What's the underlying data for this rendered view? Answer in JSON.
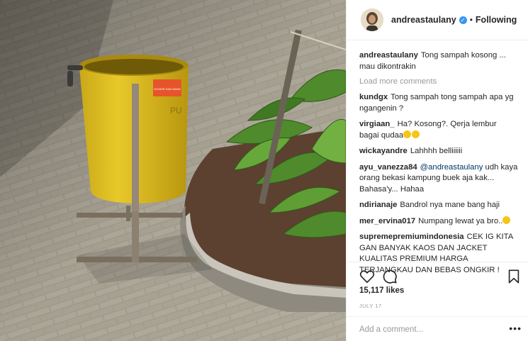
{
  "header": {
    "username": "andreastaulany",
    "verified_mark": "✓",
    "separator": "•",
    "follow_state": "Following"
  },
  "caption": {
    "username": "andreastaulany",
    "text": "Tong sampah kosong ... mau dikontrakin"
  },
  "load_more": "Load more comments",
  "comments": [
    {
      "username": "kundgx",
      "text": "Tong sampah tong sampah apa yg ngangenin ?"
    },
    {
      "username": "virgiaan_",
      "text": "Ha? Kosong?. Qerja lembur bagai qudaa"
    },
    {
      "username": "wickayandre",
      "text": "Lahhhh belliiiiii"
    },
    {
      "username": "ayu_vanezza84",
      "mention": "@andreastaulany",
      "text": "udh kaya orang bekasi kampung buek aja kak... Bahasa'y... Hahaa"
    },
    {
      "username": "ndirianaje",
      "text": "Bandrol nya mane bang haji"
    },
    {
      "username": "mer_ervina017",
      "text": "Numpang lewat ya bro.."
    },
    {
      "username": "supremepremiumindonesia",
      "text": "CEK IG KITA GAN BANYAK KAOS DAN JACKET KUALITAS PREMIUM HARGA TERJANGKAU DAN BEBAS ONGKIR !"
    }
  ],
  "likes": "15,117 likes",
  "date": "JULY 17",
  "add_comment_placeholder": "Add a comment...",
  "more_options": "•••",
  "photo_sticker_text": "NOMOR DAN NAMA",
  "photo_can_text": "PU",
  "icons": [
    "heart-icon",
    "comment-icon",
    "bookmark-icon"
  ],
  "colors": {
    "verified": "#3897f0",
    "can": "#e5c21d",
    "link": "#003569",
    "muted": "#999999"
  }
}
